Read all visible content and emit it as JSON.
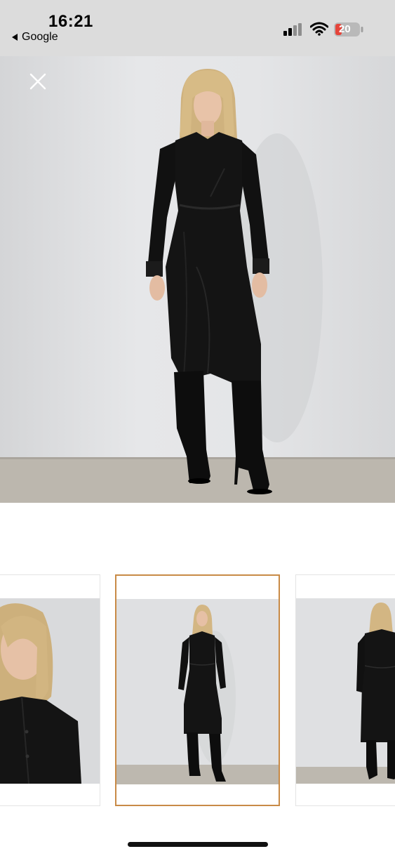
{
  "status_bar": {
    "time": "16:21",
    "back_label": "Google",
    "battery_level": "20",
    "battery_color": "#e5443a",
    "icons": [
      "signal-icon",
      "wifi-icon",
      "battery-icon"
    ]
  },
  "gallery": {
    "close_icon": "close-icon",
    "selected_index": 1,
    "thumbnails": [
      "close-up-portrait",
      "front-full-length",
      "back-full-length"
    ],
    "selected_border_color": "#c88a46"
  }
}
